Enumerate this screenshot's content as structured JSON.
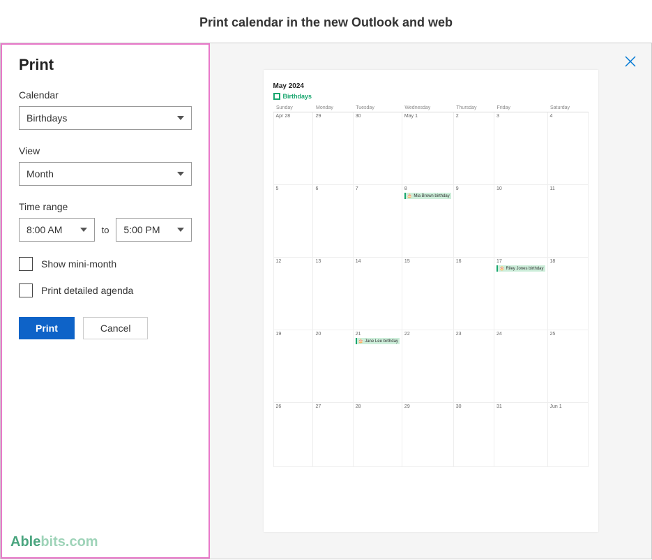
{
  "pageTitle": "Print calendar in the new Outlook and web",
  "panel": {
    "heading": "Print",
    "calendarLabel": "Calendar",
    "calendarValue": "Birthdays",
    "viewLabel": "View",
    "viewValue": "Month",
    "timeRangeLabel": "Time range",
    "timeFrom": "8:00 AM",
    "timeToWord": "to",
    "timeTo": "5:00 PM",
    "showMiniMonth": "Show mini-month",
    "printDetailed": "Print detailed agenda",
    "printBtn": "Print",
    "cancelBtn": "Cancel"
  },
  "preview": {
    "monthTitle": "May 2024",
    "calendarName": "Birthdays",
    "dayHeaders": [
      "Sunday",
      "Monday",
      "Tuesday",
      "Wednesday",
      "Thursday",
      "Friday",
      "Saturday"
    ],
    "weeks": [
      [
        {
          "label": "Apr 28"
        },
        {
          "label": "29"
        },
        {
          "label": "30"
        },
        {
          "label": "May 1"
        },
        {
          "label": "2"
        },
        {
          "label": "3"
        },
        {
          "label": "4"
        }
      ],
      [
        {
          "label": "5"
        },
        {
          "label": "6"
        },
        {
          "label": "7"
        },
        {
          "label": "8",
          "event": "Mia Brown birthday"
        },
        {
          "label": "9"
        },
        {
          "label": "10"
        },
        {
          "label": "11"
        }
      ],
      [
        {
          "label": "12"
        },
        {
          "label": "13"
        },
        {
          "label": "14"
        },
        {
          "label": "15"
        },
        {
          "label": "16"
        },
        {
          "label": "17",
          "event": "Riley Jones birthday"
        },
        {
          "label": "18"
        }
      ],
      [
        {
          "label": "19"
        },
        {
          "label": "20"
        },
        {
          "label": "21",
          "event": "Jane Lee birthday"
        },
        {
          "label": "22"
        },
        {
          "label": "23"
        },
        {
          "label": "24"
        },
        {
          "label": "25"
        }
      ],
      [
        {
          "label": "26"
        },
        {
          "label": "27"
        },
        {
          "label": "28"
        },
        {
          "label": "29"
        },
        {
          "label": "30"
        },
        {
          "label": "31"
        },
        {
          "label": "Jun 1"
        }
      ]
    ]
  },
  "logo": {
    "part1": "Able",
    "part2": "bits",
    "suffix": ".com"
  }
}
